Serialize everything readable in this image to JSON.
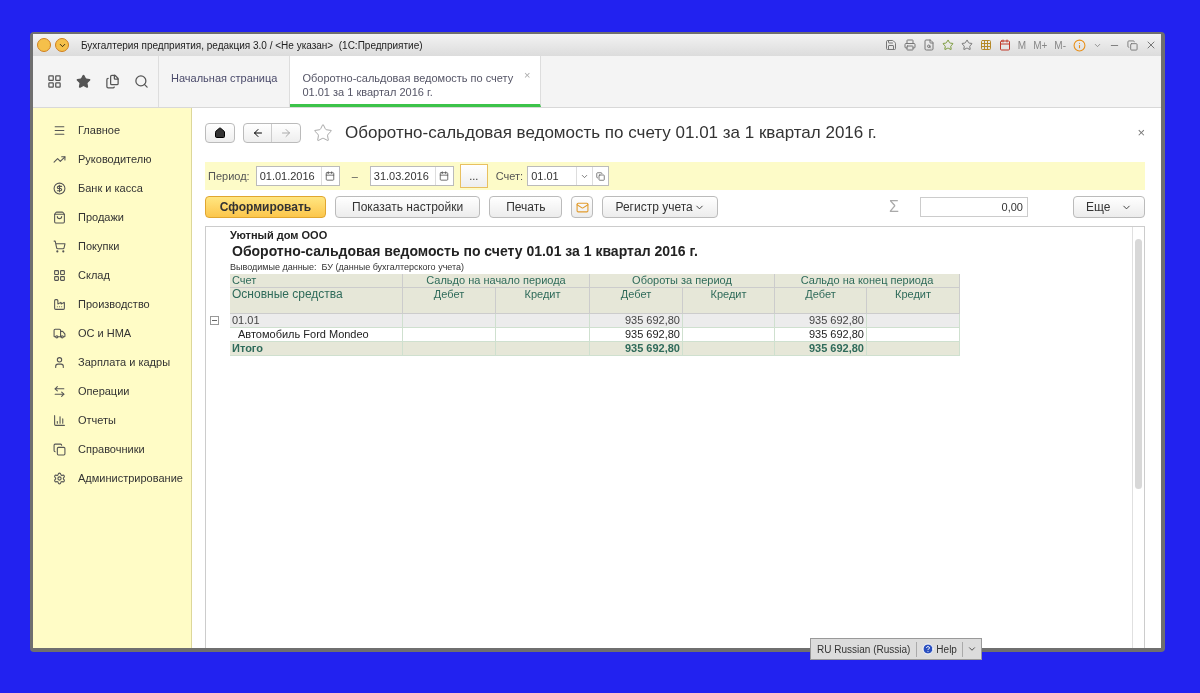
{
  "window": {
    "title": "Бухгалтерия предприятия, редакция 3.0 / <Не указан>  (1С:Предприятие)",
    "memory_buttons": [
      "M",
      "M+",
      "M-"
    ]
  },
  "tabs": [
    {
      "label": "Начальная страница",
      "selected": false
    },
    {
      "label": "Оборотно-сальдовая ведомость по счету 01.01 за 1 квартал 2016 г.",
      "selected": true,
      "close": "×"
    }
  ],
  "sidebar": {
    "items": [
      {
        "label": "Главное"
      },
      {
        "label": "Руководителю"
      },
      {
        "label": "Банк и касса"
      },
      {
        "label": "Продажи"
      },
      {
        "label": "Покупки"
      },
      {
        "label": "Склад"
      },
      {
        "label": "Производство"
      },
      {
        "label": "ОС и НМА"
      },
      {
        "label": "Зарплата и кадры"
      },
      {
        "label": "Операции"
      },
      {
        "label": "Отчеты"
      },
      {
        "label": "Справочники"
      },
      {
        "label": "Администрирование"
      }
    ]
  },
  "form": {
    "title": "Оборотно-сальдовая ведомость по счету 01.01 за 1 квартал 2016 г.",
    "close": "×",
    "period_label": "Период:",
    "date_from": "01.01.2016",
    "dash": "–",
    "date_to": "31.03.2016",
    "more": "...",
    "account_label": "Счет:",
    "account": "01.01",
    "buttons": [
      {
        "label": "Сформировать",
        "kind": "primary"
      },
      {
        "label": "Показать настройки",
        "kind": "plain"
      },
      {
        "label": "Печать",
        "kind": "plain"
      },
      {
        "kind": "mail"
      },
      {
        "label": "Регистр учета",
        "kind": "dropdown"
      }
    ],
    "sum_sign": "Σ",
    "sum_value": "0,00",
    "more_button": "Еще"
  },
  "report": {
    "organization": "Уютный дом ООО",
    "title": "Оборотно-сальдовая ведомость по счету 01.01 за 1 квартал 2016 г.",
    "output_note": "Выводимые данные:  БУ (данные бухгалтерского учета)",
    "header_groups": [
      "Счет",
      "Сальдо на начало периода",
      "Обороты за период",
      "Сальдо на конец периода"
    ],
    "header_sub": [
      "Основные средства",
      "Дебет",
      "Кредит",
      "Дебет",
      "Кредит",
      "Дебет",
      "Кредит"
    ],
    "rows": [
      {
        "kind": "group",
        "expanded": true,
        "cells": [
          "01.01",
          "",
          "",
          "935 692,80",
          "",
          "935 692,80",
          ""
        ]
      },
      {
        "kind": "item",
        "cells": [
          "Автомобиль Ford Mondeo",
          "",
          "",
          "935 692,80",
          "",
          "935 692,80",
          ""
        ]
      },
      {
        "kind": "total",
        "cells": [
          "Итого",
          "",
          "",
          "935 692,80",
          "",
          "935 692,80",
          ""
        ]
      }
    ]
  },
  "language_bar": {
    "language": "RU Russian (Russia)",
    "help": "Help"
  }
}
